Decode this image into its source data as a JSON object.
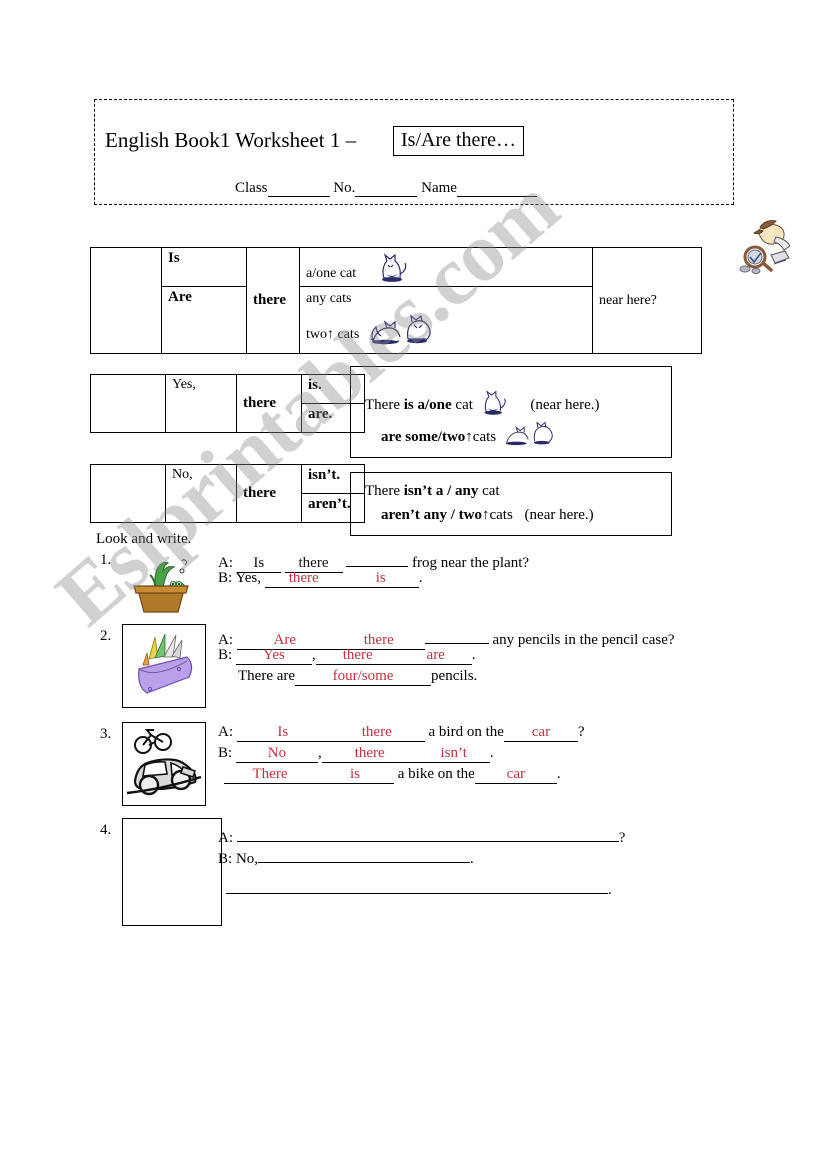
{
  "header": {
    "title": "English Book1 Worksheet 1 –",
    "topic": "Is/Are there…",
    "class_label": "Class",
    "no_label": "No.",
    "name_label": "Name"
  },
  "question_table": {
    "aux_singular": "Is",
    "aux_plural": "Are",
    "there": "there",
    "object_singular": "a/one cat",
    "object_any": "any cats",
    "object_plural": "two↑ cats",
    "tail": "near here?"
  },
  "affirmative_table": {
    "yes": "Yes,",
    "there": "there",
    "is": "is.",
    "are": "are."
  },
  "affirmative_example": {
    "line1_prefix": "There ",
    "line1_bold": "is a/one",
    "line1_suffix": " cat",
    "line1_tail": "(near here.)",
    "line2_bold": "are some/two↑",
    "line2_suffix": "cats"
  },
  "negative_table": {
    "no": "No,",
    "there": "there",
    "isnt": "isn’t.",
    "arent": "aren’t."
  },
  "negative_example": {
    "line1_prefix": "There ",
    "line1_bold": "isn’t a / any",
    "line1_suffix": " cat",
    "line2_bold": "aren’t any / two↑",
    "line2_suffix": "cats",
    "line2_tail": "(near here.)"
  },
  "instruction": "Look and write.",
  "exercises": [
    {
      "number": "1.",
      "image": "plant-pot-with-frog",
      "a_speaker": "A:",
      "a_answer1": "Is",
      "a_answer1_color": "black",
      "a_answer2": "there",
      "a_answer2_color": "black",
      "a_answer3": "",
      "a_text": "frog near the plant?",
      "b_speaker": "B:",
      "b_prefix": "Yes,",
      "b_answer1": "there",
      "b_answer1_color": "red",
      "b_answer2": "is",
      "b_answer2_color": "red",
      "b_end": ".",
      "c_line": null
    },
    {
      "number": "2.",
      "image": "pencil-case",
      "a_speaker": "A:",
      "a_answer1": "Are",
      "a_answer1_color": "red",
      "a_answer2": "there",
      "a_answer2_color": "red",
      "a_answer3": "",
      "a_text": "any pencils in the pencil case?",
      "b_speaker": "B:",
      "b_prefix": "",
      "b_answer1": "Yes",
      "b_answer1_color": "red",
      "b_comma": ",",
      "b_answer2": "there",
      "b_answer2_color": "red",
      "b_answer3": "are",
      "b_answer3_color": "red",
      "b_end": ".",
      "c_prefix": "There are",
      "c_answer": "four/some",
      "c_answer_color": "red",
      "c_suffix": "pencils."
    },
    {
      "number": "3.",
      "image": "car-with-bikes",
      "a_speaker": "A:",
      "a_answer1": "Is",
      "a_answer1_color": "red",
      "a_answer2": "there",
      "a_answer2_color": "red",
      "a_mid": "a bird on the",
      "a_answer3": "car",
      "a_answer3_color": "red",
      "a_end": "?",
      "b_speaker": "B:",
      "b_answer1": "No",
      "b_answer1_color": "red",
      "b_comma": ",",
      "b_answer2": "there",
      "b_answer2_color": "red",
      "b_answer3": "isn’t",
      "b_answer3_color": "red",
      "b_end": ".",
      "c_answer1": "There",
      "c_answer1_color": "red",
      "c_answer2": "is",
      "c_answer2_color": "red",
      "c_mid": "a bike on the",
      "c_answer3": "car",
      "c_answer3_color": "red",
      "c_end": "."
    },
    {
      "number": "4.",
      "image": "empty-box",
      "a_speaker": "A:",
      "a_answer1": "",
      "a_end": "?",
      "b_speaker": "B:",
      "b_prefix": "No,",
      "b_answer1": "",
      "b_end": ".",
      "c_answer1": "",
      "c_end": "."
    }
  ],
  "watermark": "Eslprintables.com"
}
